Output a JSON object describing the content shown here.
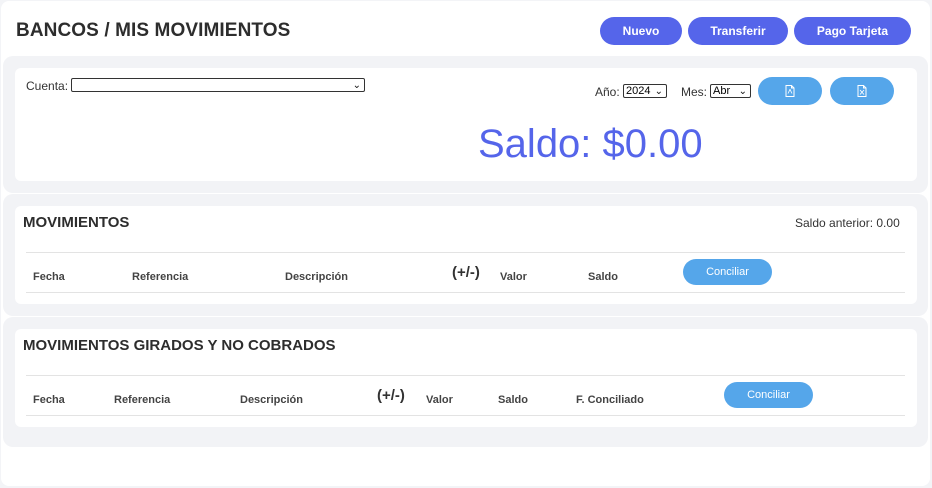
{
  "header": {
    "title": "BANCOS / MIS MOVIMIENTOS",
    "buttons": {
      "nuevo": "Nuevo",
      "transferir": "Transferir",
      "pago_tarjeta": "Pago Tarjeta"
    }
  },
  "filters": {
    "cuenta_label": "Cuenta:",
    "cuenta_value": "",
    "anio_label": "Año:",
    "anio_value": "2024",
    "mes_label": "Mes:",
    "mes_value": "Abr",
    "export_buttons": [
      "pdf-file-icon",
      "excel-file-icon"
    ]
  },
  "saldo": {
    "text": "Saldo: $0.00"
  },
  "movimientos": {
    "title": "MOVIMIENTOS",
    "saldo_anterior": "Saldo anterior: 0.00",
    "columns": [
      "Fecha",
      "Referencia",
      "Descripción",
      "(+/-)",
      "Valor",
      "Saldo"
    ],
    "action": "Conciliar"
  },
  "girados": {
    "title": "MOVIMIENTOS GIRADOS Y NO COBRADOS",
    "columns": [
      "Fecha",
      "Referencia",
      "Descripción",
      "(+/-)",
      "Valor",
      "Saldo",
      "F. Conciliado"
    ],
    "action": "Conciliar"
  },
  "colors": {
    "primary": "#5565ea",
    "secondary": "#55a6ea",
    "background": "#f2f3f6"
  }
}
